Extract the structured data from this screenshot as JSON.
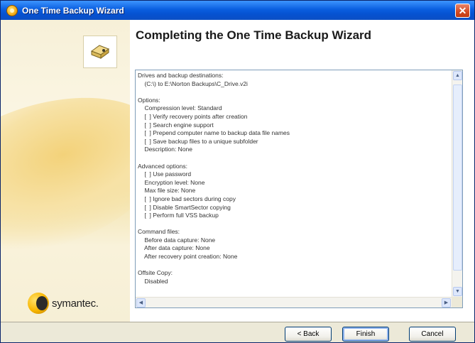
{
  "window": {
    "title": "One Time Backup Wizard",
    "close_label": "✕"
  },
  "sidebar": {
    "brand": "symantec."
  },
  "main": {
    "heading": "Completing the One Time Backup Wizard",
    "summary_lines": [
      "Drives and backup destinations:",
      "    (C:\\) to E:\\Norton Backups\\C_Drive.v2i",
      "",
      "Options:",
      "    Compression level: Standard",
      "    [  ] Verify recovery points after creation",
      "    [  ] Search engine support",
      "    [  ] Prepend computer name to backup data file names",
      "    [  ] Save backup files to a unique subfolder",
      "    Description: None",
      "",
      "Advanced options:",
      "    [  ] Use password",
      "    Encryption level: None",
      "    Max file size: None",
      "    [  ] Ignore bad sectors during copy",
      "    [  ] Disable SmartSector copying",
      "    [  ] Perform full VSS backup",
      "",
      "Command files:",
      "    Before data capture: None",
      "    After data capture: None",
      "    After recovery point creation: None",
      "",
      "Offsite Copy:",
      "    Disabled"
    ]
  },
  "buttons": {
    "back": "< Back",
    "finish": "Finish",
    "cancel": "Cancel"
  },
  "colors": {
    "titlebar": "#0a5fe0",
    "sidebar_accent": "#f3d27a",
    "brand_yellow": "#f7b500"
  }
}
